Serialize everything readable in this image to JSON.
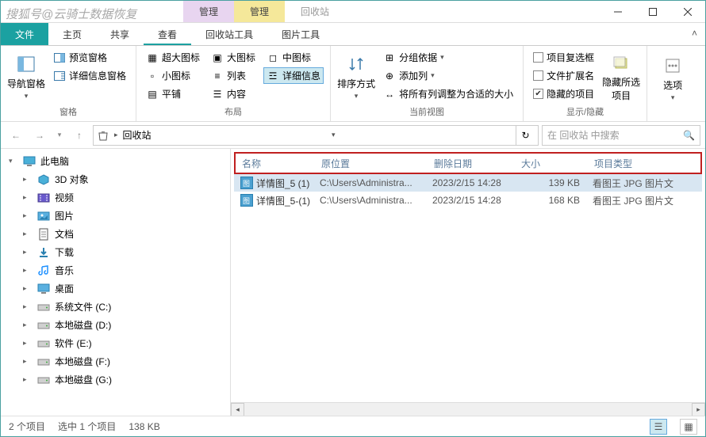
{
  "watermark": "搜狐号@云骑士数据恢复",
  "title_extra_tabs": [
    {
      "label": "管理",
      "style": "purple"
    },
    {
      "label": "管理",
      "style": "yellow"
    }
  ],
  "window_title": "回收站",
  "menu": {
    "file": "文件",
    "tabs": [
      "主页",
      "共享",
      "查看",
      "回收站工具",
      "图片工具"
    ],
    "active": "查看"
  },
  "ribbon": {
    "panes": {
      "nav_pane": "导航窗格",
      "preview_pane": "预览窗格",
      "details_pane": "详细信息窗格",
      "group_label": "窗格"
    },
    "layout": {
      "extra_large": "超大图标",
      "large": "大图标",
      "medium": "中图标",
      "small": "小图标",
      "list": "列表",
      "details": "详细信息",
      "tiles": "平铺",
      "content": "内容",
      "group_label": "布局"
    },
    "current_view": {
      "sort_by": "排序方式",
      "group_by": "分组依据",
      "add_columns": "添加列",
      "size_all": "将所有列调整为合适的大小",
      "group_label": "当前视图"
    },
    "show_hide": {
      "item_checkboxes": "项目复选框",
      "file_ext": "文件扩展名",
      "hidden_items": "隐藏的项目",
      "hide_selected": "隐藏所选项目",
      "options": "选项",
      "group_label": "显示/隐藏"
    }
  },
  "address": {
    "segments": [
      "回收站"
    ]
  },
  "search": {
    "placeholder": "在 回收站 中搜索"
  },
  "sidebar": {
    "this_pc": "此电脑",
    "items": [
      {
        "label": "3D 对象",
        "icon": "cube"
      },
      {
        "label": "视频",
        "icon": "video"
      },
      {
        "label": "图片",
        "icon": "pictures"
      },
      {
        "label": "文档",
        "icon": "docs"
      },
      {
        "label": "下载",
        "icon": "downloads"
      },
      {
        "label": "音乐",
        "icon": "music"
      },
      {
        "label": "桌面",
        "icon": "desktop"
      },
      {
        "label": "系统文件 (C:)",
        "icon": "drive"
      },
      {
        "label": "本地磁盘 (D:)",
        "icon": "drive"
      },
      {
        "label": "软件 (E:)",
        "icon": "drive"
      },
      {
        "label": "本地磁盘 (F:)",
        "icon": "drive"
      },
      {
        "label": "本地磁盘 (G:)",
        "icon": "drive"
      }
    ]
  },
  "columns": {
    "name": "名称",
    "location": "原位置",
    "date": "删除日期",
    "size": "大小",
    "type": "项目类型"
  },
  "files": [
    {
      "name": "详情图_5 (1)",
      "location": "C:\\Users\\Administra...",
      "date": "2023/2/15 14:28",
      "size": "139 KB",
      "type": "看图王 JPG 图片文",
      "selected": true
    },
    {
      "name": "详情图_5-(1)",
      "location": "C:\\Users\\Administra...",
      "date": "2023/2/15 14:28",
      "size": "168 KB",
      "type": "看图王 JPG 图片文",
      "selected": false
    }
  ],
  "status": {
    "count": "2 个项目",
    "selection": "选中 1 个项目",
    "size": "138 KB"
  }
}
